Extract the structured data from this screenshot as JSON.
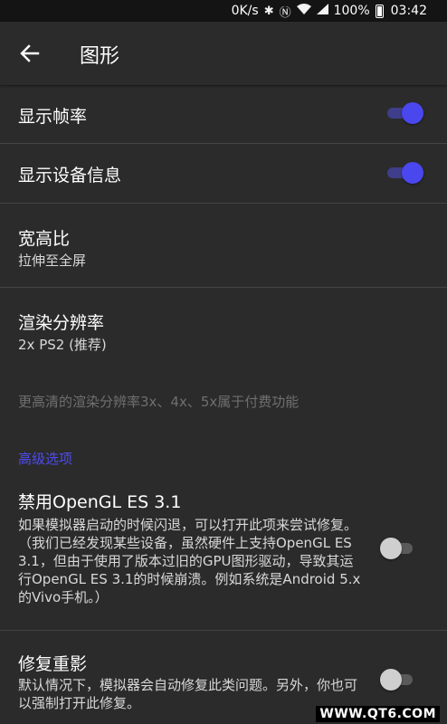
{
  "status_bar": {
    "network_speed": "0K/s",
    "bluetooth_icon": "bluetooth-icon",
    "nfc_icon": "nfc-icon",
    "wifi_icon": "wifi-icon",
    "signal_icon": "signal-icon",
    "battery_percent": "100%",
    "battery_icon": "battery-icon",
    "time": "03:42"
  },
  "app_bar": {
    "back_icon": "arrow-left-icon",
    "title": "图形"
  },
  "settings": {
    "show_fps": {
      "label": "显示帧率",
      "enabled": true
    },
    "show_device_info": {
      "label": "显示设备信息",
      "enabled": true
    },
    "aspect_ratio": {
      "label": "宽高比",
      "value": "拉伸至全屏"
    },
    "render_resolution": {
      "label": "渲染分辨率",
      "value": "2x PS2 (推荐)"
    },
    "resolution_note": "更高清的渲染分辨率3x、4x、5x属于付费功能",
    "advanced_header": "高级选项",
    "disable_opengl": {
      "label": "禁用OpenGL ES 3.1",
      "description": "如果模拟器启动的时候闪退，可以打开此项来尝试修复。（我们已经发现某些设备，虽然硬件上支持OpenGL ES 3.1，但由于使用了版本过旧的GPU图形驱动，导致其运行OpenGL ES 3.1的时候崩溃。例如系统是Android 5.x的Vivo手机。）",
      "enabled": false
    },
    "fix_ghosting": {
      "label": "修复重影",
      "description": "默认情况下，模拟器会自动修复此类问题。另外，你也可以强制打开此修复。",
      "enabled": false
    }
  },
  "watermark": "WWW.QT6.COM",
  "colors": {
    "accent": "#4a47ee",
    "background": "#2b2b2b",
    "status_bar": "#141414",
    "divider": "#444444"
  }
}
